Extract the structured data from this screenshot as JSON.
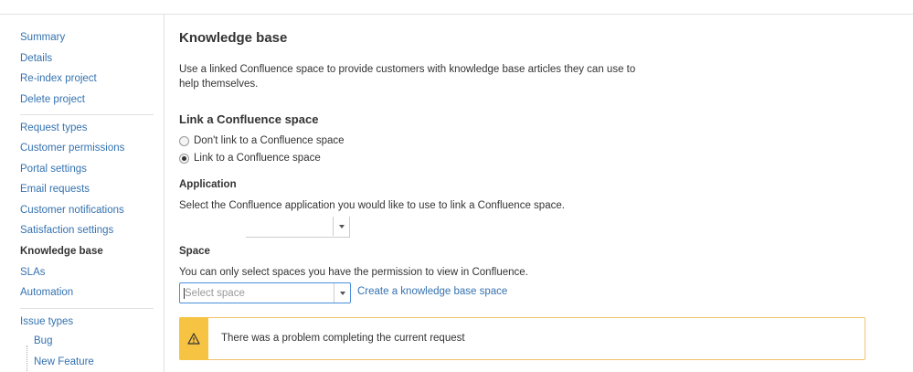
{
  "sidebar": {
    "group1": [
      "Summary",
      "Details",
      "Re-index project",
      "Delete project"
    ],
    "group2": [
      "Request types",
      "Customer permissions",
      "Portal settings",
      "Email requests",
      "Customer notifications",
      "Satisfaction settings",
      "Knowledge base",
      "SLAs",
      "Automation"
    ],
    "active": "Knowledge base",
    "issue_types_label": "Issue types",
    "issue_types": [
      "Bug",
      "New Feature"
    ]
  },
  "main": {
    "title": "Knowledge base",
    "description": "Use a linked Confluence space to provide customers with knowledge base articles they can use to help themselves.",
    "link_section_title": "Link a Confluence space",
    "radio_options": [
      {
        "label": "Don't link to a Confluence space",
        "checked": false
      },
      {
        "label": "Link to a Confluence space",
        "checked": true
      }
    ],
    "application": {
      "label": "Application",
      "help": "Select the Confluence application you would like to use to link a Confluence space.",
      "value": ""
    },
    "space": {
      "label": "Space",
      "help": "You can only select spaces you have the permission to view in Confluence.",
      "placeholder": "Select space",
      "create_link": "Create a knowledge base space"
    },
    "alert": {
      "type": "warning",
      "message": "There was a problem completing the current request"
    }
  },
  "colors": {
    "link": "#3572b0",
    "warning": "#f6c342",
    "warning_border": "#f0c36d",
    "focus_border": "#4a90d9"
  }
}
